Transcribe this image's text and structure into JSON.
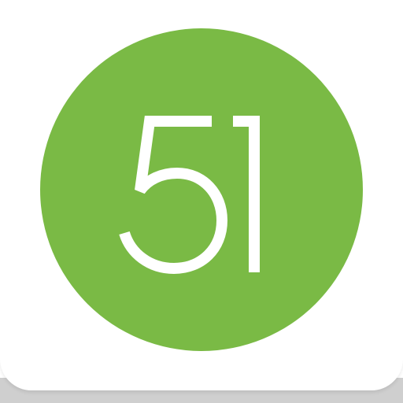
{
  "app_icon": {
    "logo_text": "51",
    "colors": {
      "circle": "#7aba45",
      "digits": "#ffffff",
      "icon_background": "#ffffff",
      "shadow": "#cfcfcf"
    }
  }
}
